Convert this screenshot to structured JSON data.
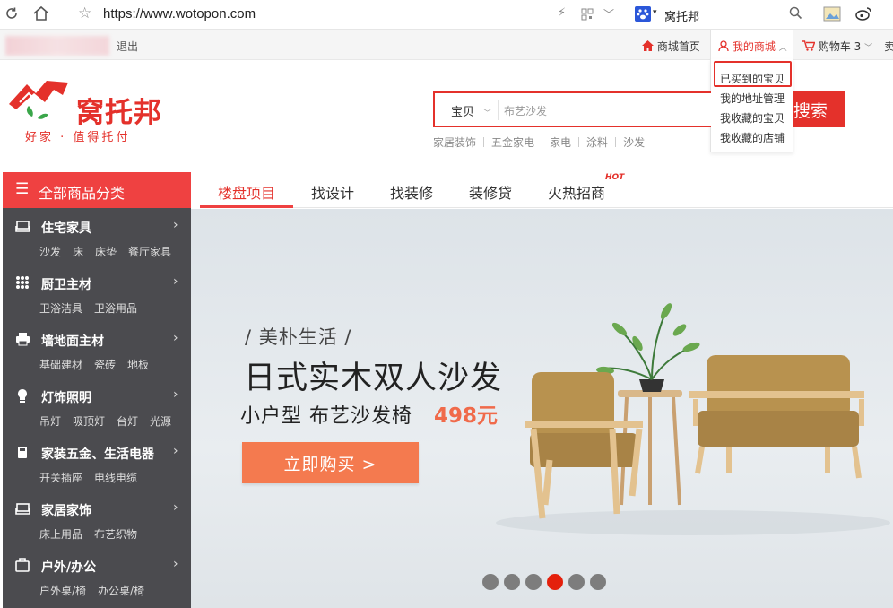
{
  "browser": {
    "url": "https://www.wotopon.com",
    "site_name": "窝托邦"
  },
  "topnav": {
    "logout": "退出",
    "mall_home": "商城首页",
    "my_mall": "我的商城",
    "cart": "购物车",
    "cart_count": "3",
    "seller": "卖"
  },
  "dropdown": {
    "items": [
      "已买到的宝贝",
      "我的地址管理",
      "我收藏的宝贝",
      "我收藏的店铺"
    ],
    "highlighted_index": 0
  },
  "header": {
    "logo_text": "窝托邦",
    "logo_slogan": "好家 · 值得托付",
    "search_type": "宝贝",
    "search_placeholder": "布艺沙发",
    "search_button": "搜索",
    "hot_words": [
      "家居装饰",
      "五金家电",
      "家电",
      "涂料",
      "沙发"
    ]
  },
  "sidebar": {
    "title": "全部商品分类",
    "categories": [
      {
        "name": "住宅家具",
        "icon": "sofa-icon",
        "subs": [
          "沙发",
          "床",
          "床垫",
          "餐厅家具"
        ]
      },
      {
        "name": "厨卫主材",
        "icon": "grid-icon",
        "subs": [
          "卫浴洁具",
          "卫浴用品"
        ]
      },
      {
        "name": "墙地面主材",
        "icon": "printer-icon",
        "subs": [
          "基础建材",
          "瓷砖",
          "地板"
        ]
      },
      {
        "name": "灯饰照明",
        "icon": "bulb-icon",
        "subs": [
          "吊灯",
          "吸顶灯",
          "台灯",
          "光源"
        ]
      },
      {
        "name": "家装五金、生活电器",
        "icon": "appliance-icon",
        "subs": [
          "开关插座",
          "电线电缆"
        ]
      },
      {
        "name": "家居家饰",
        "icon": "home-decor-icon",
        "subs": [
          "床上用品",
          "布艺织物"
        ]
      },
      {
        "name": "户外/办公",
        "icon": "briefcase-icon",
        "subs": [
          "户外桌/椅",
          "办公桌/椅"
        ]
      }
    ]
  },
  "tabs": {
    "items": [
      "楼盘项目",
      "找设计",
      "找装修",
      "装修贷",
      "火热招商"
    ],
    "active_index": 0,
    "hot_badge": "HOT"
  },
  "banner": {
    "kicker": "/ 美朴生活 /",
    "title": "日式实木双人沙发",
    "subtitle": "小户型 布艺沙发椅",
    "price": "498元",
    "buy_button": "立即购买 >",
    "slide_count": 6,
    "active_slide": 3
  },
  "colors": {
    "brand_red": "#e4312b",
    "sidebar_bg": "#4b4b4f",
    "banner_button": "#f47a4f"
  }
}
